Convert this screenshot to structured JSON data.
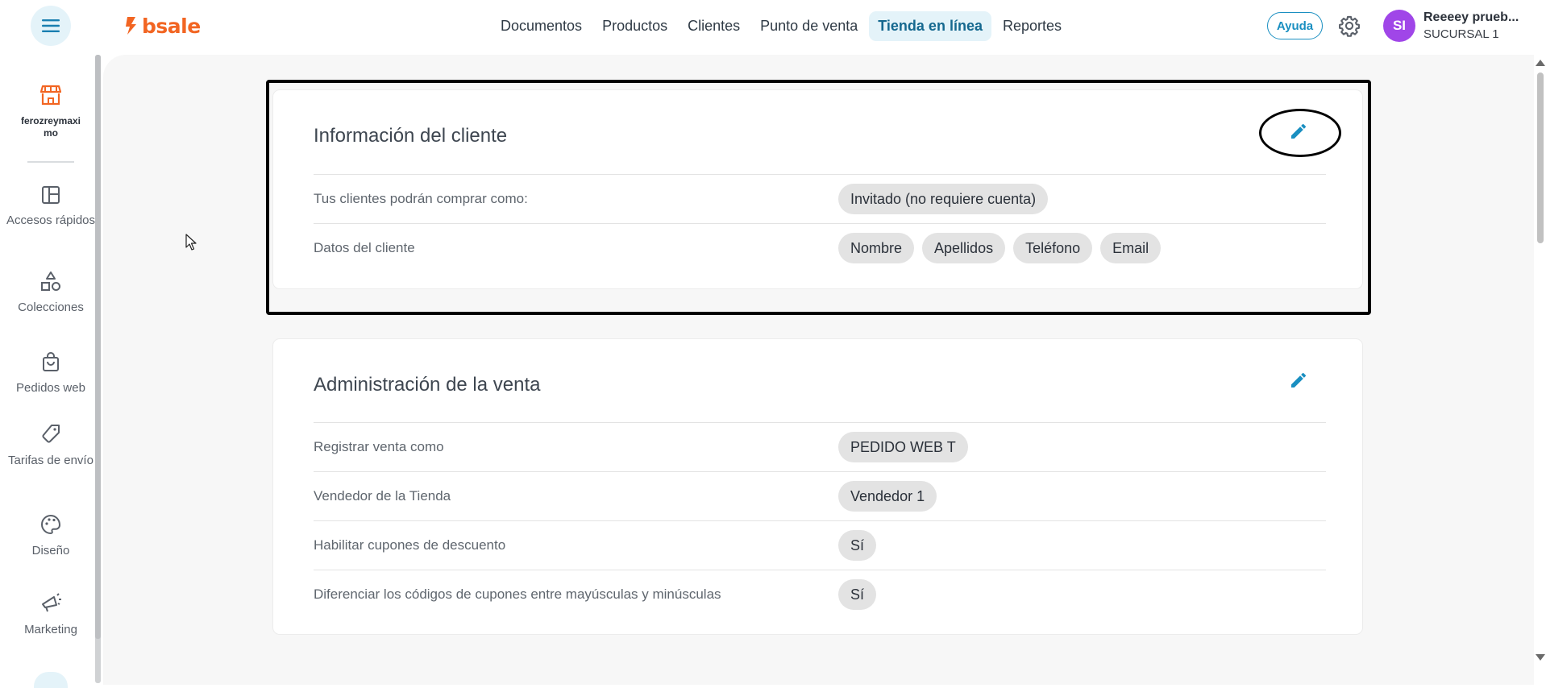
{
  "header": {
    "logo_text": "bsale",
    "nav": [
      {
        "label": "Documentos",
        "active": false
      },
      {
        "label": "Productos",
        "active": false
      },
      {
        "label": "Clientes",
        "active": false
      },
      {
        "label": "Punto de venta",
        "active": false
      },
      {
        "label": "Tienda en línea",
        "active": true
      },
      {
        "label": "Reportes",
        "active": false
      }
    ],
    "help_label": "Ayuda",
    "user": {
      "initials": "SI",
      "name": "Reeeey prueb...",
      "branch": "SUCURSAL 1"
    }
  },
  "sidebar": {
    "store_name": "ferozreymaximo",
    "items": [
      {
        "label": "Accesos rápidos",
        "icon": "layout-icon"
      },
      {
        "label": "Colecciones",
        "icon": "shapes-icon"
      },
      {
        "label": "Pedidos web",
        "icon": "shopping-bag-icon"
      },
      {
        "label": "Tarifas de envío",
        "icon": "tag-icon"
      },
      {
        "label": "Diseño",
        "icon": "palette-icon"
      },
      {
        "label": "Marketing",
        "icon": "megaphone-icon"
      }
    ]
  },
  "cards": [
    {
      "title": "Información del cliente",
      "rows": [
        {
          "label": "Tus clientes podrán comprar como:",
          "chips": [
            "Invitado (no requiere cuenta)"
          ]
        },
        {
          "label": "Datos del cliente",
          "chips": [
            "Nombre",
            "Apellidos",
            "Teléfono",
            "Email"
          ]
        }
      ]
    },
    {
      "title": "Administración de la venta",
      "rows": [
        {
          "label": "Registrar venta como",
          "chips": [
            "PEDIDO WEB T"
          ]
        },
        {
          "label": "Vendedor de la Tienda",
          "chips": [
            "Vendedor 1"
          ]
        },
        {
          "label": "Habilitar cupones de descuento",
          "chips": [
            "Sí"
          ]
        },
        {
          "label": "Diferenciar los códigos de cupones entre mayúsculas y minúsculas",
          "chips": [
            "Sí"
          ]
        }
      ]
    }
  ],
  "colors": {
    "accent": "#1a8fc1",
    "brand": "#f26522",
    "nav_active_bg": "#e4f3f9",
    "avatar": "#a046e8"
  }
}
